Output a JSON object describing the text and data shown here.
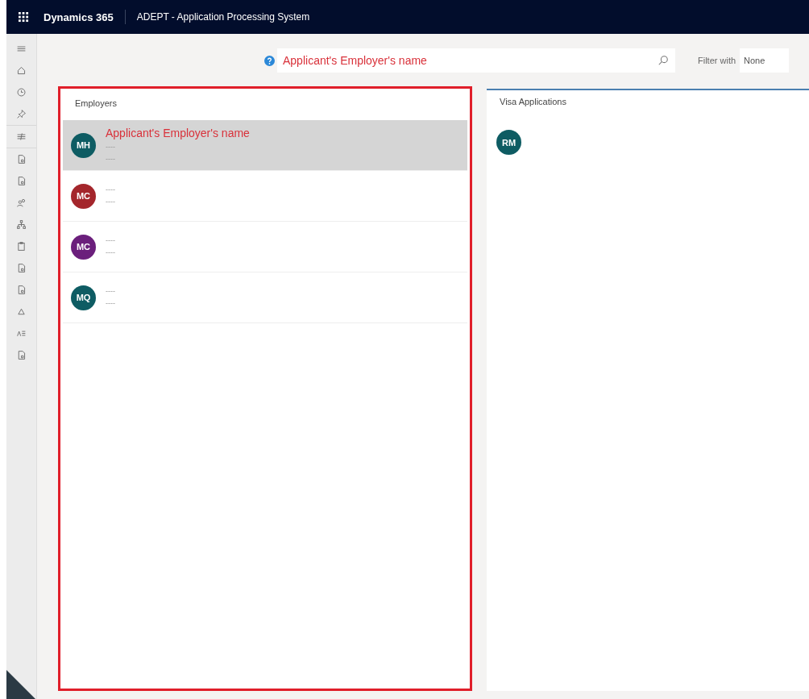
{
  "topbar": {
    "app_name": "Dynamics 365",
    "title": "ADEPT - Application Processing System"
  },
  "search": {
    "value": "Applicant's Employer's name",
    "filter_label": "Filter with",
    "filter_value": "None"
  },
  "employers": {
    "title": "Employers",
    "items": [
      {
        "initials": "MH",
        "color": "#0e5c63",
        "name": "Applicant's Employer's name",
        "lines": [
          "----",
          "----"
        ],
        "selected": true
      },
      {
        "initials": "MC",
        "color": "#a4262c",
        "lines": [
          "----",
          "----"
        ],
        "selected": false
      },
      {
        "initials": "MC",
        "color": "#6b1f7c",
        "lines": [
          "----",
          "----"
        ],
        "selected": false
      },
      {
        "initials": "MQ",
        "color": "#0e5c63",
        "lines": [
          "----",
          "----"
        ],
        "selected": false
      }
    ]
  },
  "visa_applications": {
    "title": "Visa Applications",
    "items": [
      {
        "initials": "RM",
        "color": "#0e5c63"
      }
    ]
  }
}
